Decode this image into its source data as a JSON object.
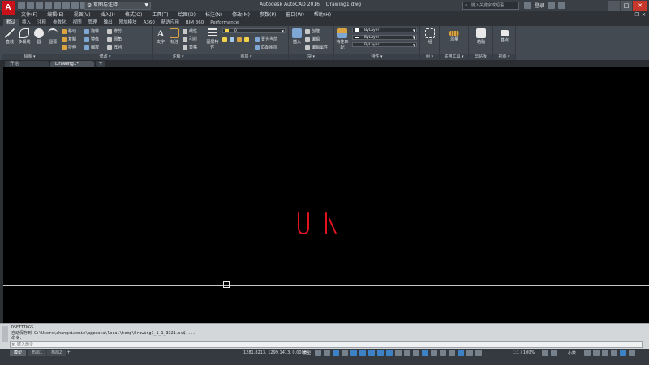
{
  "titlebar": {
    "logo": "A",
    "workspace": "草图与注释",
    "app_name": "Autodesk AutoCAD 2016",
    "document_name": "Drawing1.dwg",
    "search_placeholder": "键入关键字或短语",
    "user": "登录"
  },
  "menu": [
    "文件(F)",
    "编辑(E)",
    "视图(V)",
    "插入(I)",
    "格式(O)",
    "工具(T)",
    "绘图(D)",
    "标注(N)",
    "修改(M)",
    "参数(P)",
    "窗口(W)",
    "帮助(H)"
  ],
  "ribbon_tabs": [
    "默认",
    "插入",
    "注释",
    "参数化",
    "视图",
    "管理",
    "输出",
    "附加模块",
    "A360",
    "精选应用",
    "BIM 360",
    "Performance"
  ],
  "panels": {
    "draw": {
      "title": "绘图 ▾",
      "tools": [
        "直线",
        "多段线",
        "圆",
        "圆弧"
      ]
    },
    "modify": {
      "title": "修改 ▾",
      "rows": [
        [
          "移动",
          "旋转",
          "修剪"
        ],
        [
          "复制",
          "镜像",
          "圆角"
        ],
        [
          "拉伸",
          "缩放",
          "阵列"
        ]
      ]
    },
    "annotation": {
      "title": "注释 ▾",
      "tools": [
        "文字",
        "标注"
      ],
      "rows": [
        "线性",
        "引线",
        "表格"
      ]
    },
    "layers": {
      "title": "图层 ▾",
      "tools": [
        "图层特性"
      ],
      "layer_name": "0",
      "rows": [
        "置为当前",
        "匹配图层"
      ]
    },
    "block": {
      "title": "块 ▾",
      "tools": [
        "插入"
      ],
      "rows": [
        "创建",
        "编辑",
        "编辑属性"
      ]
    },
    "properties": {
      "title": "特性 ▾",
      "tools": [
        "特性匹配"
      ],
      "color": "ByLayer",
      "linetype": "ByLayer",
      "lineweight": "ByLayer"
    },
    "groups": {
      "title": "组 ▾",
      "tools": [
        "组"
      ]
    },
    "utilities": {
      "title": "实用工具 ▾",
      "tools": [
        "测量"
      ]
    },
    "clipboard": {
      "title": "剪贴板",
      "tools": [
        "粘贴"
      ]
    },
    "view": {
      "title": "视图 ▾",
      "tools": [
        "基点"
      ]
    }
  },
  "file_tabs": [
    {
      "label": "开始"
    },
    {
      "label": "Drawing1*",
      "close": "×"
    }
  ],
  "file_tab_add": "+",
  "command": {
    "history": [
      "DSETTINGS",
      "自动保存到 C:\\Users\\zhangxiaomin\\appdata\\local\\temp\\Drawing1_1_1_3321.sv$ ...",
      "命令:"
    ],
    "input_placeholder": "键入命令",
    "close_glyph": "×"
  },
  "status": {
    "layout_tabs": [
      "模型",
      "布局1",
      "布局2"
    ],
    "coordinates": "1281.8213, 1299.1413, 0.0000",
    "space": "模型",
    "annotation_scale": "1:1 / 100%",
    "units": "小数"
  },
  "colors": {
    "accent": "#c8111b",
    "sketch": "#e0141e",
    "crosshair": "#c8c8c8",
    "canvas": "#000000"
  }
}
